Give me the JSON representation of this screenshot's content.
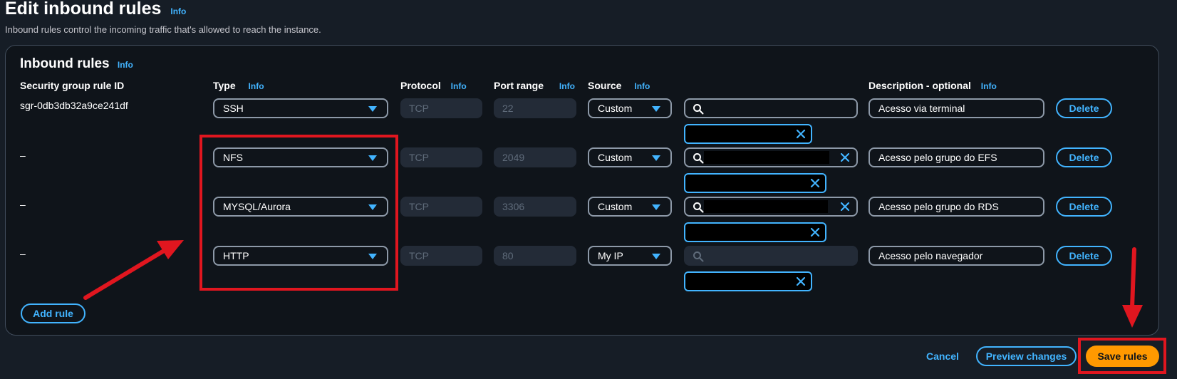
{
  "page": {
    "title": "Edit inbound rules",
    "info_label": "Info",
    "description": "Inbound rules control the incoming traffic that's allowed to reach the instance."
  },
  "panel": {
    "title": "Inbound rules",
    "info_label": "Info",
    "columns": {
      "rule_id": "Security group rule ID",
      "type": "Type",
      "protocol": "Protocol",
      "port_range": "Port range",
      "source": "Source",
      "description": "Description - optional"
    }
  },
  "rules": [
    {
      "rule_id": "sgr-0db3db32a9ce241df",
      "type": "SSH",
      "protocol": "TCP",
      "port": "22",
      "source": "Custom",
      "description": "Acesso via terminal",
      "delete_label": "Delete"
    },
    {
      "rule_id": "–",
      "type": "NFS",
      "protocol": "TCP",
      "port": "2049",
      "source": "Custom",
      "description": "Acesso pelo grupo do EFS",
      "delete_label": "Delete"
    },
    {
      "rule_id": "–",
      "type": "MYSQL/Aurora",
      "protocol": "TCP",
      "port": "3306",
      "source": "Custom",
      "description": "Acesso pelo grupo do RDS",
      "delete_label": "Delete"
    },
    {
      "rule_id": "–",
      "type": "HTTP",
      "protocol": "TCP",
      "port": "80",
      "source": "My IP",
      "description": "Acesso pelo navegador",
      "delete_label": "Delete"
    }
  ],
  "actions": {
    "add_rule": "Add rule",
    "cancel": "Cancel",
    "preview": "Preview changes",
    "save": "Save rules"
  },
  "colors": {
    "background": "#161d26",
    "panel": "#0f141a",
    "accent_blue": "#42b4ff",
    "primary_orange": "#ff9900",
    "annotation_red": "#e0161f"
  }
}
